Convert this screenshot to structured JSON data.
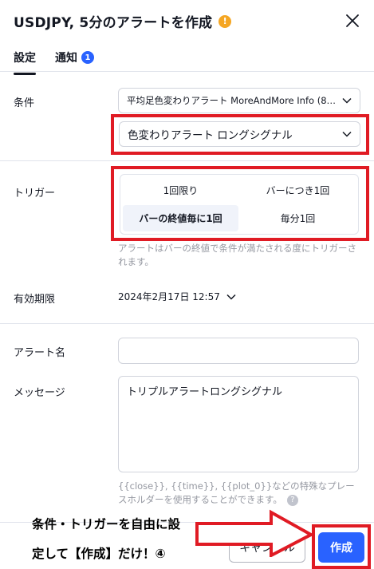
{
  "header": {
    "title": "USDJPY, 5分のアラートを作成",
    "warn_symbol": "!"
  },
  "tabs": [
    {
      "label": "設定"
    },
    {
      "label": "通知",
      "badge": "1"
    }
  ],
  "condition": {
    "label": "条件",
    "indicator": "平均足色変わりアラート MoreAndMore Info (8, ...",
    "signal": "色変わりアラート ロングシグナル"
  },
  "trigger": {
    "label": "トリガー",
    "options": [
      "1回限り",
      "バーにつき1回",
      "バーの終値毎に1回",
      "毎分1回"
    ],
    "selected": "バーの終値毎に1回",
    "hint": "アラートはバーの終値で条件が満たされる度にトリガーされます。"
  },
  "expiry": {
    "label": "有効期限",
    "value": "2024年2月17日 12:57"
  },
  "alert_name": {
    "label": "アラート名",
    "value": ""
  },
  "message": {
    "label": "メッセージ",
    "value": "トリプルアラートロングシグナル",
    "hint": "{{close}}, {{time}}, {{plot_0}}などの特殊なプレースホルダーを使用することができます。",
    "help_symbol": "?"
  },
  "annotation": {
    "line1": "条件・トリガーを自由に設",
    "line2": "定して【作成】だけ！④"
  },
  "footer": {
    "cancel_label": "キャンセル",
    "create_label": "作成"
  },
  "colors": {
    "accent": "#2962ff",
    "warning": "#f5a623",
    "highlight_border": "#e01b24"
  }
}
